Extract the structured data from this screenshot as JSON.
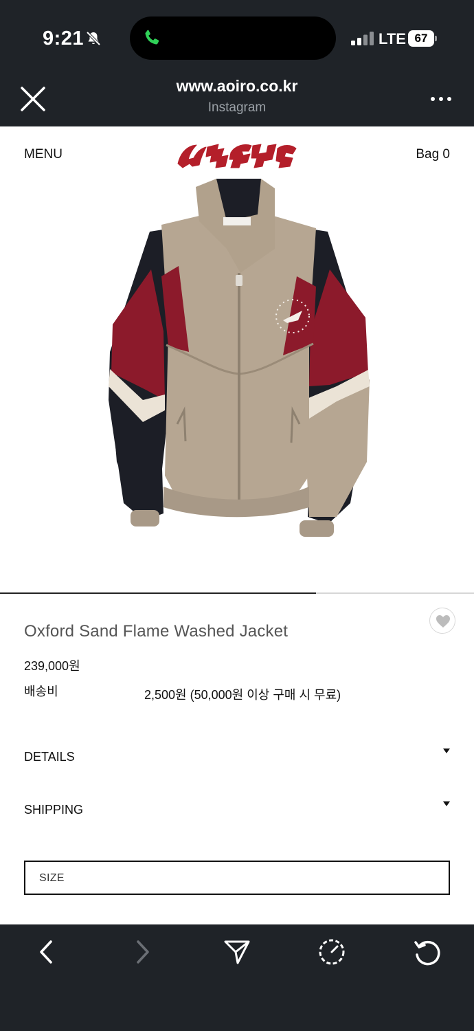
{
  "status_bar": {
    "time": "9:21",
    "network": "LTE",
    "battery": "67",
    "icons": [
      "bell-slash-icon",
      "phone-icon",
      "signal-icon",
      "battery-icon"
    ]
  },
  "browser": {
    "url": "www.aoiro.co.kr",
    "source": "Instagram",
    "icons": [
      "close-icon",
      "more-icon"
    ]
  },
  "nav": {
    "menu": "MENU",
    "bag": "Bag 0",
    "brand_color": "#b41f2a"
  },
  "gallery": {
    "progress": 0.667
  },
  "product": {
    "title": "Oxford Sand Flame Washed Jacket",
    "price": "239,000원",
    "shipping_label": "배송비",
    "shipping_value": "2,500원 (50,000원 이상 구매 시 무료)",
    "details_label": "DETAILS",
    "shipping_section_label": "SHIPPING",
    "size_label": "SIZE"
  },
  "toolbar": {
    "icons": [
      "back-icon",
      "forward-icon",
      "share-icon",
      "speed-icon",
      "reload-icon"
    ]
  }
}
